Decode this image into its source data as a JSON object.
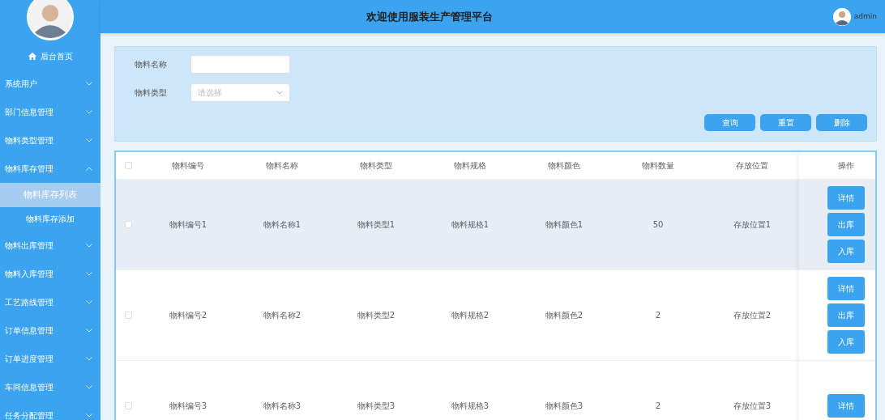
{
  "header": {
    "title": "欢迎使用服装生产管理平台",
    "user": "admin"
  },
  "sidebar": {
    "home": "后台首页",
    "items": [
      {
        "label": "系统用户",
        "expanded": false
      },
      {
        "label": "部门信息管理",
        "expanded": false
      },
      {
        "label": "物料类型管理",
        "expanded": false
      },
      {
        "label": "物料库存管理",
        "expanded": true,
        "children": [
          {
            "label": "物料库存列表",
            "selected": true
          },
          {
            "label": "物料库存添加",
            "selected": false
          }
        ]
      },
      {
        "label": "物料出库管理",
        "expanded": false
      },
      {
        "label": "物料入库管理",
        "expanded": false
      },
      {
        "label": "工艺路线管理",
        "expanded": false
      },
      {
        "label": "订单信息管理",
        "expanded": false
      },
      {
        "label": "订单进度管理",
        "expanded": false
      },
      {
        "label": "车间信息管理",
        "expanded": false
      },
      {
        "label": "任务分配管理",
        "expanded": false
      }
    ]
  },
  "search": {
    "fields": [
      {
        "label": "物料名称",
        "kind": "input"
      },
      {
        "label": "物料类型",
        "kind": "select",
        "placeholder": "请选择"
      }
    ],
    "buttons": [
      "查询",
      "重置",
      "删除"
    ]
  },
  "table": {
    "header_checked": false,
    "columns": [
      "物料编号",
      "物料名称",
      "物料类型",
      "物料规格",
      "物料颜色",
      "物料数量",
      "存放位置",
      "操作"
    ],
    "rows": [
      {
        "checked": false,
        "hovered": true,
        "cells": [
          "物料编号1",
          "物料名称1",
          "物料类型1",
          "物料规格1",
          "物料颜色1",
          "50",
          "存放位置1"
        ],
        "actions": [
          "详情",
          "出库",
          "入库"
        ]
      },
      {
        "checked": false,
        "hovered": false,
        "cells": [
          "物料编号2",
          "物料名称2",
          "物料类型2",
          "物料规格2",
          "物料颜色2",
          "2",
          "存放位置2"
        ],
        "actions": [
          "详情",
          "出库",
          "入库"
        ]
      },
      {
        "checked": false,
        "hovered": false,
        "cells": [
          "物料编号3",
          "物料名称3",
          "物料类型3",
          "物料规格3",
          "物料颜色3",
          "2",
          "存放位置3"
        ],
        "actions": [
          "详情"
        ]
      }
    ]
  }
}
